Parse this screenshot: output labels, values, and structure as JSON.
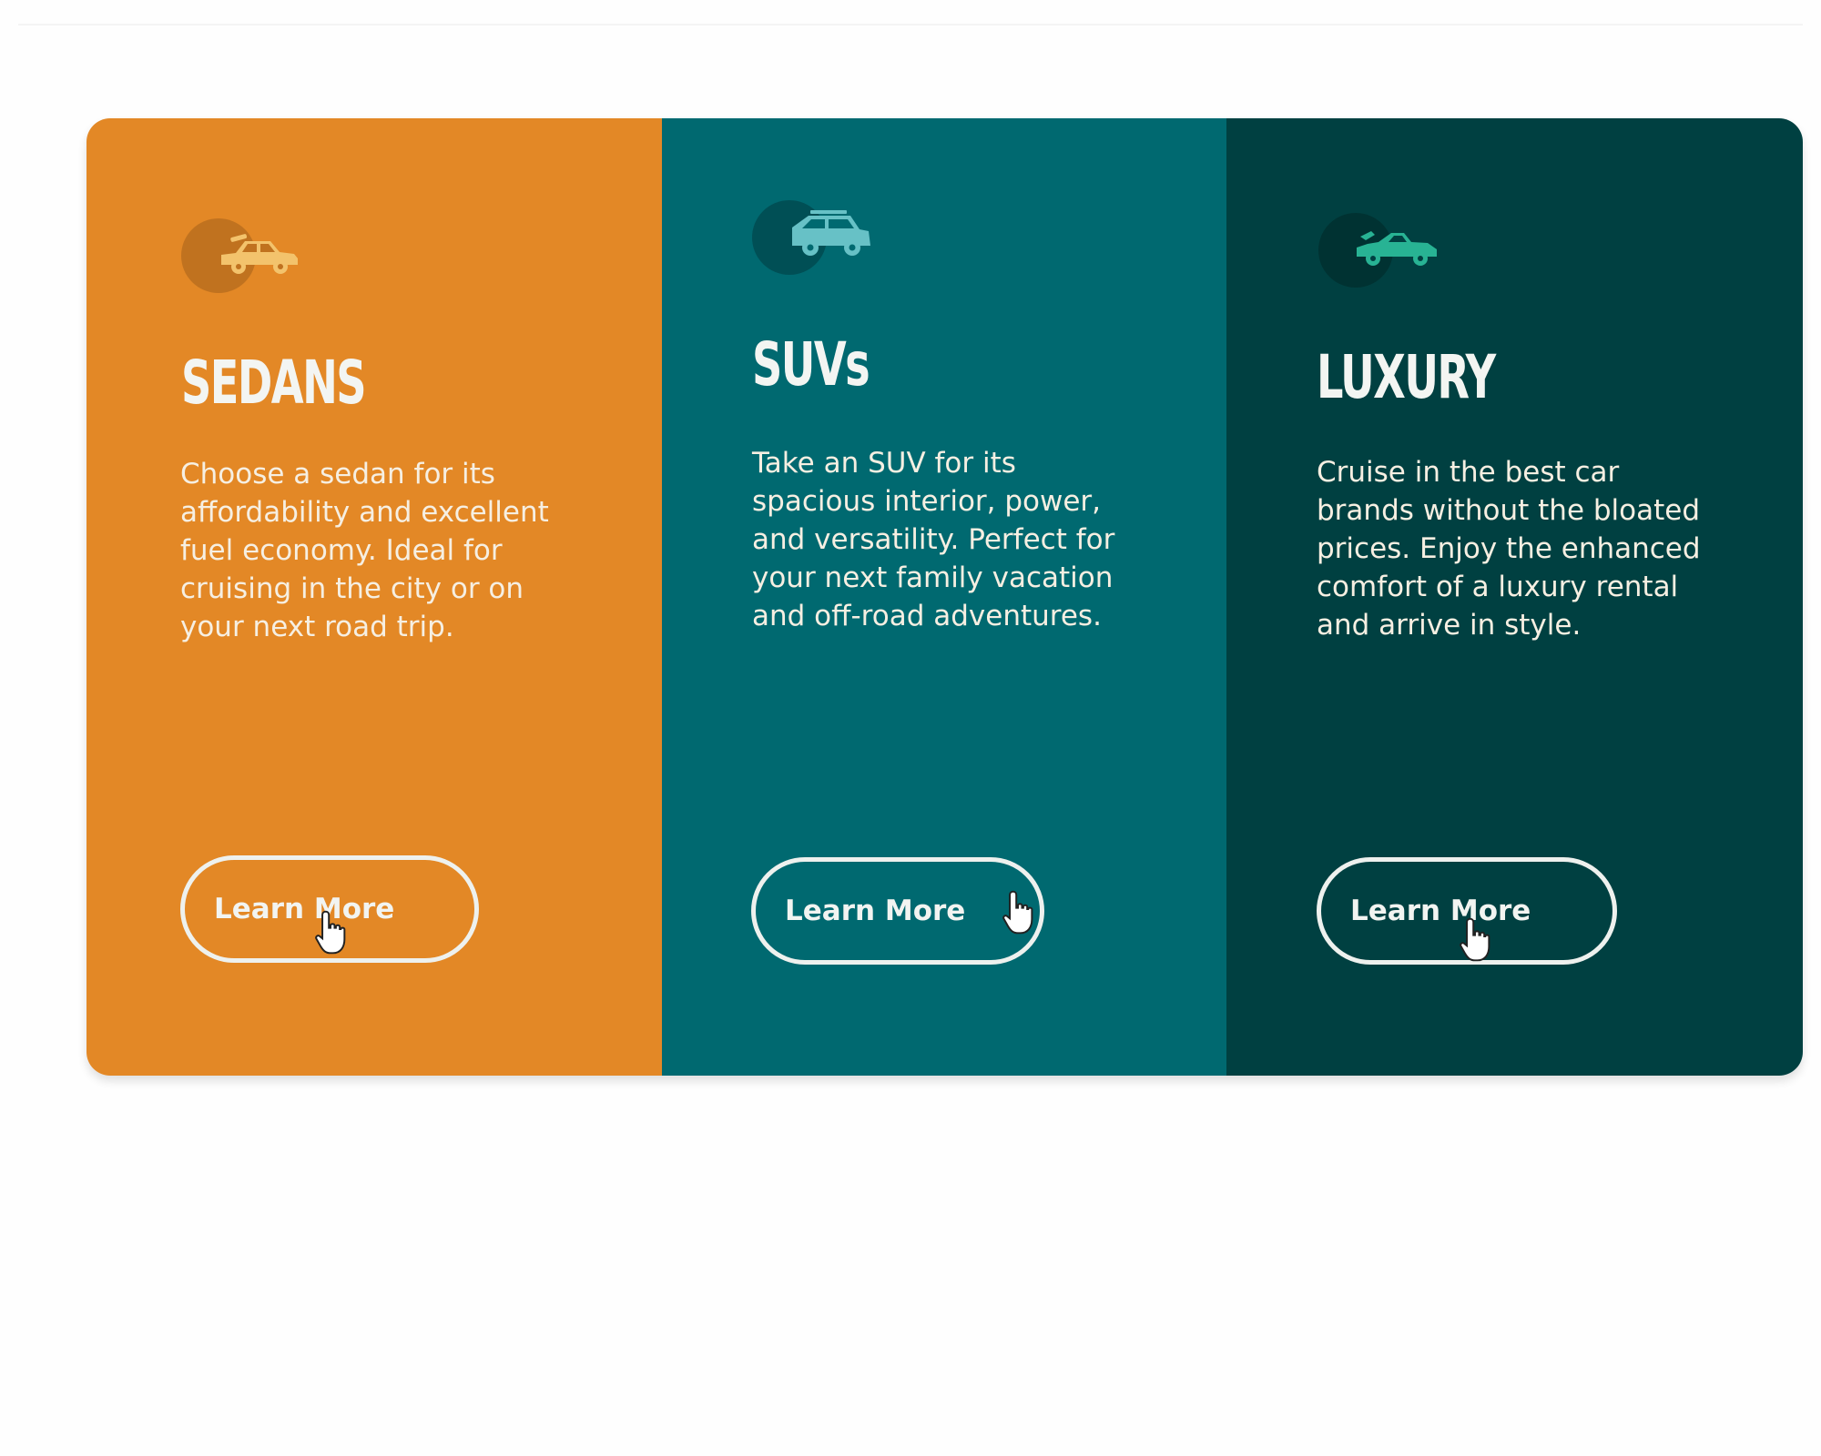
{
  "colors": {
    "sedans_bg": "#e38826",
    "suvs_bg": "#006970",
    "luxury_bg": "#004041",
    "sedans_icon": "#f3c36c",
    "suvs_icon": "#67c1c6",
    "luxury_icon": "#28b394",
    "text_light": "#f2f4f1"
  },
  "cards": [
    {
      "icon": "sedan-car-icon",
      "title": "SEDANS",
      "text": "Choose a sedan for its affordability and excellent fuel economy. Ideal for cruising in the city or on your next road trip.",
      "button_label": "Learn More"
    },
    {
      "icon": "suv-car-icon",
      "title": "SUVs",
      "text": "Take an SUV for its spacious interior, power, and versatility. Perfect for your next family vacation and off-road adventures.",
      "button_label": "Learn More"
    },
    {
      "icon": "luxury-car-icon",
      "title": "LUXURY",
      "text": "Cruise in the best car brands without the bloated prices. Enjoy the enhanced comfort of a luxury rental and arrive in style.",
      "button_label": "Learn More"
    }
  ]
}
